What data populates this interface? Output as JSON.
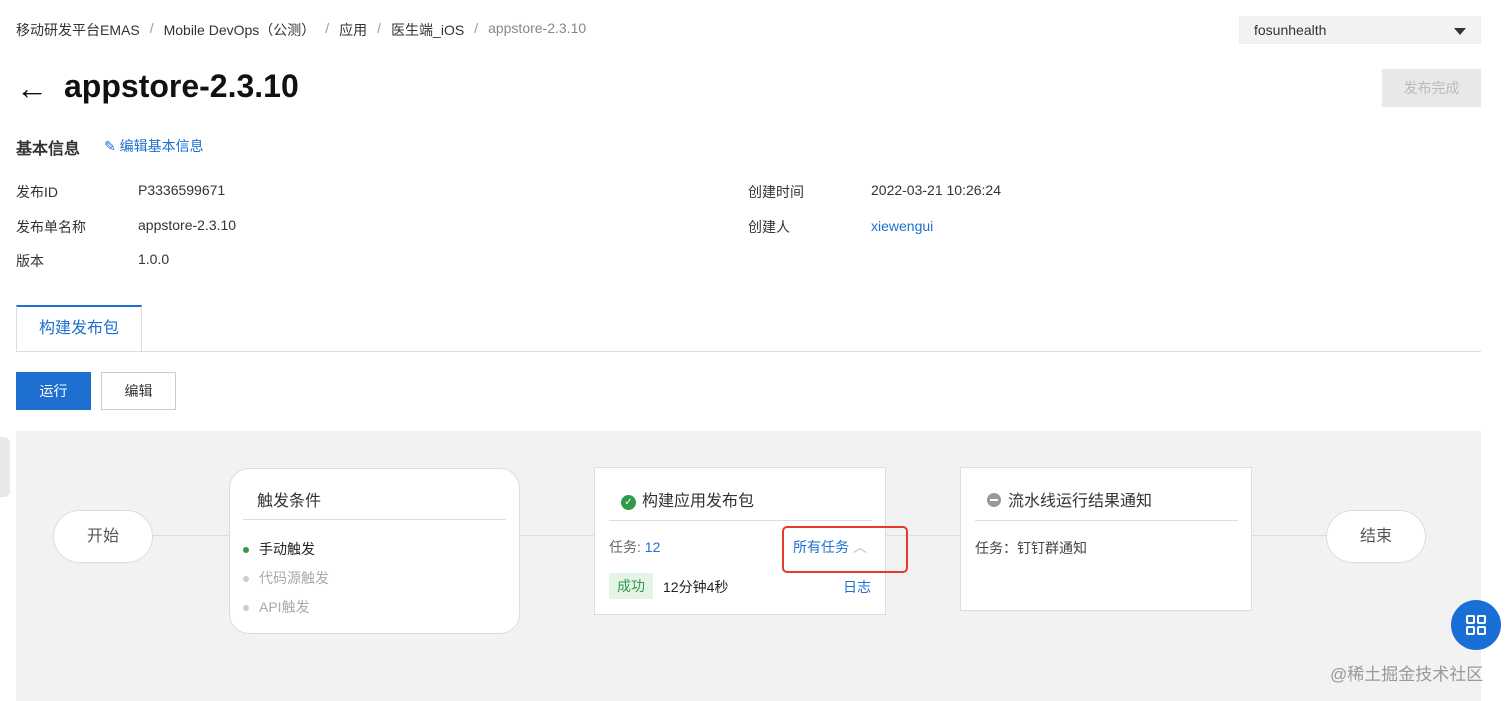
{
  "breadcrumb": [
    "移动研发平台EMAS",
    "Mobile DevOps（公测）",
    "应用",
    "医生端_iOS",
    "appstore-2.3.10"
  ],
  "org_select": "fosunhealth",
  "title": "appstore-2.3.10",
  "publish_done_label": "发布完成",
  "basic_info": {
    "heading": "基本信息",
    "edit_label": "编辑基本信息",
    "left": [
      {
        "label": "发布ID",
        "value": "P3336599671"
      },
      {
        "label": "发布单名称",
        "value": "appstore-2.3.10"
      },
      {
        "label": "版本",
        "value": "1.0.0"
      }
    ],
    "right": [
      {
        "label": "创建时间",
        "value": "2022-03-21 10:26:24"
      },
      {
        "label": "创建人",
        "value": "xiewengui"
      }
    ]
  },
  "tab": "构建发布包",
  "run_label": "运行",
  "edit_label": "编辑",
  "pipeline": {
    "start": "开始",
    "end": "结束",
    "trigger": {
      "title": "触发条件",
      "items": [
        "手动触发",
        "代码源触发",
        "API触发"
      ]
    },
    "build": {
      "title": "构建应用发布包",
      "task_label": "任务:",
      "task_count": "12",
      "all_tasks": "所有任务",
      "status": "成功",
      "duration": "12分钟4秒",
      "log": "日志"
    },
    "notify": {
      "title": "流水线运行结果通知",
      "task_text": "任务：钉钉群通知"
    }
  },
  "watermark": "@稀土掘金技术社区",
  "colors": {
    "primary": "#1e6fd0",
    "success": "#2e9b4a",
    "highlight": "#e53a2f"
  }
}
